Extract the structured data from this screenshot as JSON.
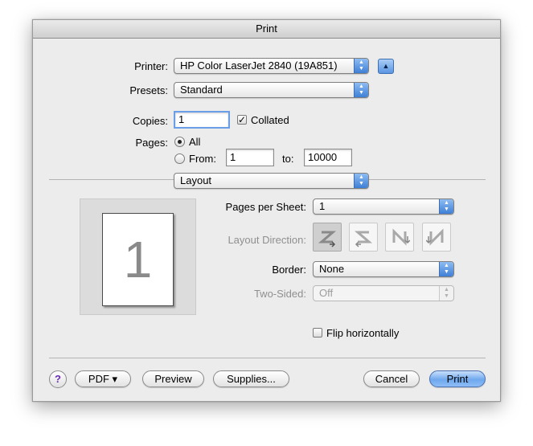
{
  "window": {
    "title": "Print"
  },
  "printer": {
    "label": "Printer:",
    "value": "HP Color LaserJet 2840 (19A851)",
    "disclosure_glyph": "▲"
  },
  "presets": {
    "label": "Presets:",
    "value": "Standard"
  },
  "copies": {
    "label": "Copies:",
    "value": "1",
    "collated_label": "Collated",
    "collated": true
  },
  "pages": {
    "label": "Pages:",
    "all_label": "All",
    "from_label": "From:",
    "from_value": "1",
    "to_label": "to:",
    "to_value": "10000",
    "selected": "All"
  },
  "section_popup": {
    "value": "Layout"
  },
  "preview": {
    "page_number": "1"
  },
  "layout": {
    "pages_per_sheet": {
      "label": "Pages per Sheet:",
      "value": "1"
    },
    "layout_direction": {
      "label": "Layout Direction:",
      "selected_index": 0
    },
    "border": {
      "label": "Border:",
      "value": "None"
    },
    "two_sided": {
      "label": "Two-Sided:",
      "value": "Off",
      "enabled": false
    },
    "flip_horizontally": {
      "label": "Flip horizontally",
      "checked": false
    }
  },
  "footer": {
    "help_glyph": "?",
    "pdf_label": "PDF ▾",
    "preview_label": "Preview",
    "supplies_label": "Supplies...",
    "cancel_label": "Cancel",
    "print_label": "Print"
  },
  "colors": {
    "accent": "#5b95e2",
    "window_bg": "#ececec",
    "disabled_text": "#8f8f8f"
  }
}
